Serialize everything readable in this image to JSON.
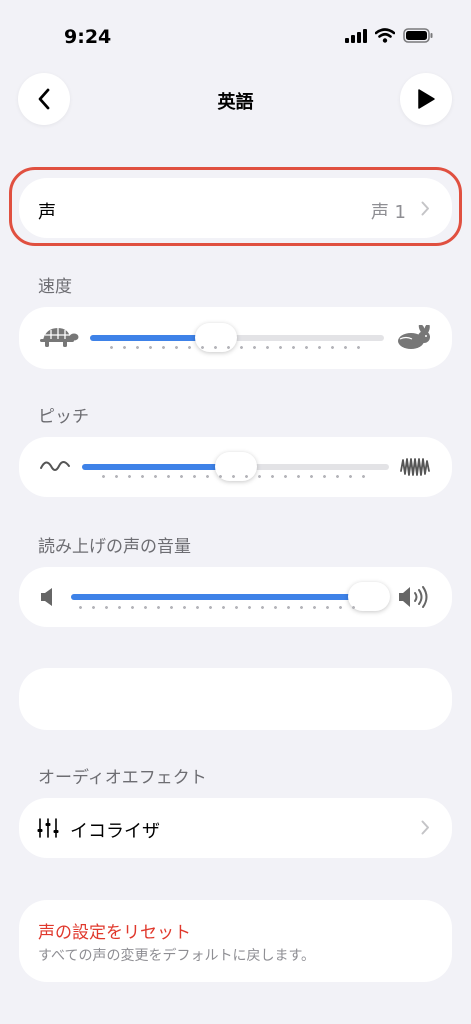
{
  "status_bar": {
    "time": "9:24"
  },
  "nav": {
    "title": "英語",
    "back_icon": "chevron-left-icon",
    "play_icon": "play-icon"
  },
  "voice": {
    "label": "声",
    "value": "声 1"
  },
  "speed": {
    "label": "速度",
    "value": 0.43
  },
  "pitch": {
    "label": "ピッチ",
    "value": 0.5
  },
  "volume": {
    "label": "読み上げの声の音量",
    "value": 0.95
  },
  "audio_effects": {
    "label": "オーディオエフェクト",
    "equalizer_label": "イコライザ"
  },
  "reset": {
    "title": "声の設定をリセット",
    "subtitle": "すべての声の変更をデフォルトに戻します。"
  },
  "colors": {
    "accent": "#3e82e8",
    "destructive": "#e0382c",
    "highlight": "#e05040"
  }
}
